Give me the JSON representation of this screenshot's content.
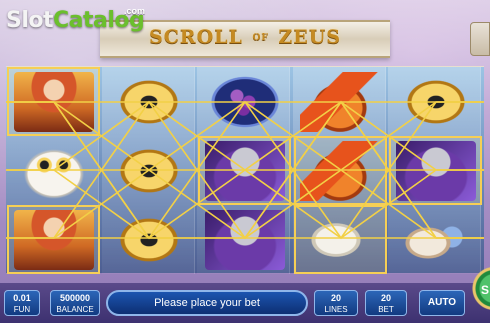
{
  "watermark": {
    "slot": "Slot",
    "catalog": "Catalog",
    "com": ".com"
  },
  "game": {
    "title_main_1": "SCROLL",
    "title_of": "OF",
    "title_main_2": "ZEUS"
  },
  "reels": {
    "columns": [
      [
        "athena",
        "owl",
        "athena"
      ],
      [
        "shield",
        "shield",
        "shield"
      ],
      [
        "grapes",
        "zeus",
        "zeus"
      ],
      [
        "helmet",
        "helmet",
        "eagle"
      ],
      [
        "shield",
        "zeus",
        "horn"
      ]
    ],
    "highlighted": [
      [
        0,
        0
      ],
      [
        0,
        2
      ],
      [
        2,
        1
      ],
      [
        3,
        1
      ],
      [
        3,
        2
      ],
      [
        4,
        1
      ]
    ]
  },
  "controls": {
    "coin_value": "0.01",
    "coin_label": "FUN",
    "balance_value": "500000",
    "balance_label": "BALANCE",
    "message": "Please place your bet",
    "lines_value": "20",
    "lines_label": "LINES",
    "bet_value": "20",
    "bet_label": "BET",
    "auto_label": "AUTO",
    "spin_label": "S"
  },
  "colors": {
    "payline": "#f2d046",
    "button_blue": "#1c55b0",
    "title_gold": "#c58a22"
  }
}
